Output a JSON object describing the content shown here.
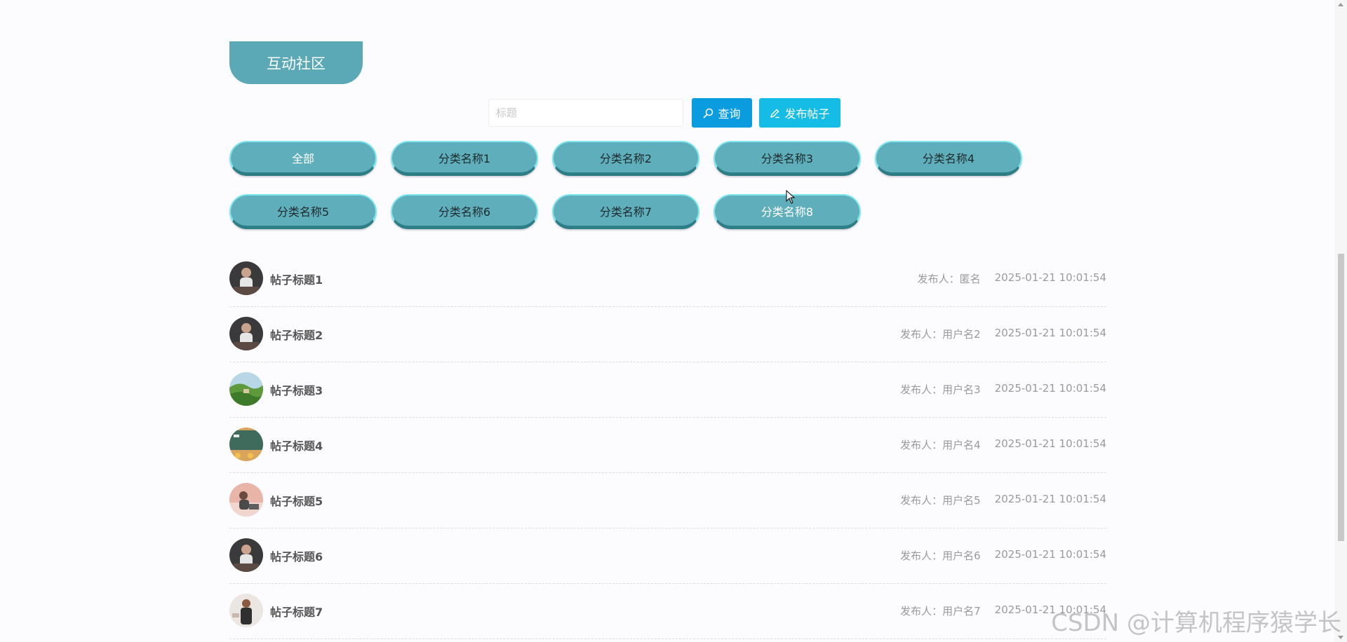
{
  "section": {
    "title": "互动社区"
  },
  "search": {
    "placeholder": "标题",
    "query_label": "查询",
    "publish_label": "发布帖子"
  },
  "categories": [
    {
      "label": "全部"
    },
    {
      "label": "分类名称1"
    },
    {
      "label": "分类名称2"
    },
    {
      "label": "分类名称3"
    },
    {
      "label": "分类名称4"
    },
    {
      "label": "分类名称5"
    },
    {
      "label": "分类名称6"
    },
    {
      "label": "分类名称7"
    },
    {
      "label": "分类名称8"
    }
  ],
  "posts": [
    {
      "title": "帖子标题1",
      "author": "发布人：匿名",
      "time": "2025-01-21 10:01:54",
      "avatar": "avatar-person-dark"
    },
    {
      "title": "帖子标题2",
      "author": "发布人：用户名2",
      "time": "2025-01-21 10:01:54",
      "avatar": "avatar-person-dark"
    },
    {
      "title": "帖子标题3",
      "author": "发布人：用户名3",
      "time": "2025-01-21 10:01:54",
      "avatar": "avatar-landscape"
    },
    {
      "title": "帖子标题4",
      "author": "发布人：用户名4",
      "time": "2025-01-21 10:01:54",
      "avatar": "avatar-classroom"
    },
    {
      "title": "帖子标题5",
      "author": "发布人：用户名5",
      "time": "2025-01-21 10:01:54",
      "avatar": "avatar-person-pink"
    },
    {
      "title": "帖子标题6",
      "author": "发布人：用户名6",
      "time": "2025-01-21 10:01:54",
      "avatar": "avatar-person-dark"
    },
    {
      "title": "帖子标题7",
      "author": "发布人：用户名7",
      "time": "2025-01-21 10:01:54",
      "avatar": "avatar-person-light"
    }
  ],
  "watermark": "CSDN @计算机程序猿学长",
  "colors": {
    "accent": "#5ba9b6",
    "query_button": "#0b9ce0",
    "publish_button": "#15bde6"
  }
}
